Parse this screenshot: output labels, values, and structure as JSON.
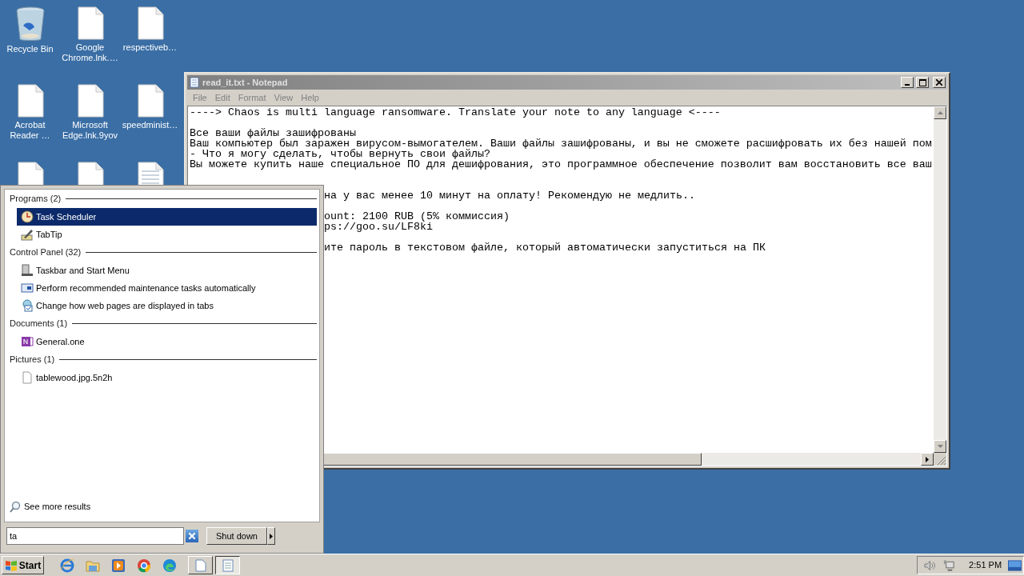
{
  "desktop": {
    "icons": [
      {
        "label": "Recycle Bin",
        "kind": "recycle"
      },
      {
        "label": "Google Chrome.lnk.…",
        "kind": "blank"
      },
      {
        "label": "respectiveb…",
        "kind": "blank"
      },
      {
        "label": "Acrobat Reader …",
        "kind": "blank"
      },
      {
        "label": "Microsoft Edge.lnk.9yov",
        "kind": "blank"
      },
      {
        "label": "speedminist…",
        "kind": "blank"
      },
      {
        "kind": "blank"
      },
      {
        "kind": "blank"
      },
      {
        "kind": "lined"
      }
    ]
  },
  "notepad": {
    "title": "read_it.txt - Notepad",
    "menu": [
      "File",
      "Edit",
      "Format",
      "View",
      "Help"
    ],
    "lines": [
      {
        "kind": "full",
        "text": "----> Chaos is multi language ransomware. Translate your note to any language <----"
      },
      {
        "kind": "blank"
      },
      {
        "kind": "full",
        "text": "Все ваши файлы зашифрованы"
      },
      {
        "kind": "full",
        "text": "Ваш компьютер был заражен вирусом-вымогателем. Ваши файлы зашифрованы, и вы не сможете расшифровать их без нашей пом"
      },
      {
        "kind": "full",
        "text": "- Что я могу сделать, чтобы вернуть свои файлы?"
      },
      {
        "kind": "full",
        "text": "Вы можете купить наше специальное ПО для дешифрования, это программное обеспечение позволит вам восстановить все ваш"
      },
      {
        "kind": "blank"
      },
      {
        "kind": "blank"
      },
      {
        "kind": "partial",
        "text": "на у вас менее 10 минут на оплату! Рекомендую не медлить.."
      },
      {
        "kind": "blank"
      },
      {
        "kind": "partial",
        "text": "ount: 2100 RUB (5% коммиссия)"
      },
      {
        "kind": "partial",
        "text": "ps://goo.su/LF8ki"
      },
      {
        "kind": "blank"
      },
      {
        "kind": "partial",
        "text": "ите пароль в текстовом файле, который автоматически запуститься на ПК"
      }
    ]
  },
  "start_menu": {
    "sections": [
      {
        "heading": "Programs (2)",
        "items": [
          {
            "label": "Task Scheduler",
            "kind": "clock",
            "selected": true
          },
          {
            "label": "TabTip",
            "kind": "pen",
            "selected": false
          }
        ]
      },
      {
        "heading": "Control Panel (32)",
        "items": [
          {
            "label": "Taskbar and Start Menu",
            "kind": "taskbar",
            "selected": false
          },
          {
            "label": "Perform recommended maintenance tasks automatically",
            "kind": "screen",
            "selected": false
          },
          {
            "label": "Change how web pages are displayed in tabs",
            "kind": "globe",
            "selected": false
          }
        ]
      },
      {
        "heading": "Documents (1)",
        "items": [
          {
            "label": "General.one",
            "kind": "note",
            "selected": false
          }
        ]
      },
      {
        "heading": "Pictures (1)",
        "items": [
          {
            "label": "tablewood.jpg.5n2h",
            "kind": "file",
            "selected": false
          }
        ]
      }
    ],
    "see_more": "See more results",
    "search": {
      "value": "ta"
    },
    "shutdown": "Shut down"
  },
  "taskbar": {
    "start": "Start",
    "clock": "2:51 PM"
  }
}
